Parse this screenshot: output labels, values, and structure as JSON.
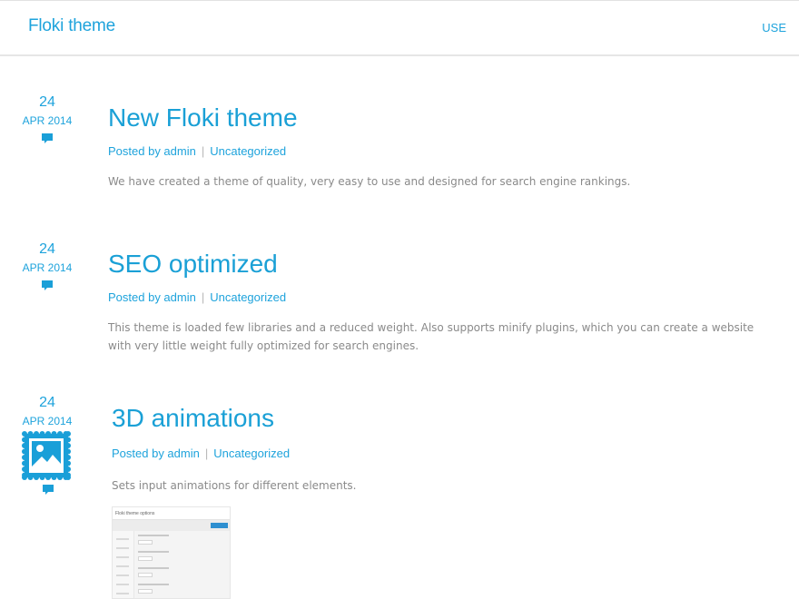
{
  "header": {
    "site_title": "Floki theme",
    "nav_link": "USE"
  },
  "posts": [
    {
      "day": "24",
      "month": "APR 2014",
      "title": "New Floki theme",
      "posted_by": "Posted by admin",
      "separator": "|",
      "category": "Uncategorized",
      "excerpt": "We have created a theme of quality, very easy to use and designed for search engine rankings."
    },
    {
      "day": "24",
      "month": "APR 2014",
      "title": "SEO optimized",
      "posted_by": "Posted by admin",
      "separator": "|",
      "category": "Uncategorized",
      "excerpt": "This theme is loaded few libraries and a reduced weight. Also supports minify plugins, which you can create a website with very little weight fully optimized for search engines."
    },
    {
      "day": "24",
      "month": "APR 2014",
      "title": "3D animations",
      "posted_by": "Posted by admin",
      "separator": "|",
      "category": "Uncategorized",
      "excerpt": "Sets input animations for different elements.",
      "format_icon": "image-stamp-icon",
      "thumbnail_header": "Floki theme options"
    }
  ],
  "colors": {
    "accent": "#1ea3dc",
    "text_muted": "#8a8a8a",
    "separator": "#b8b8b8"
  }
}
